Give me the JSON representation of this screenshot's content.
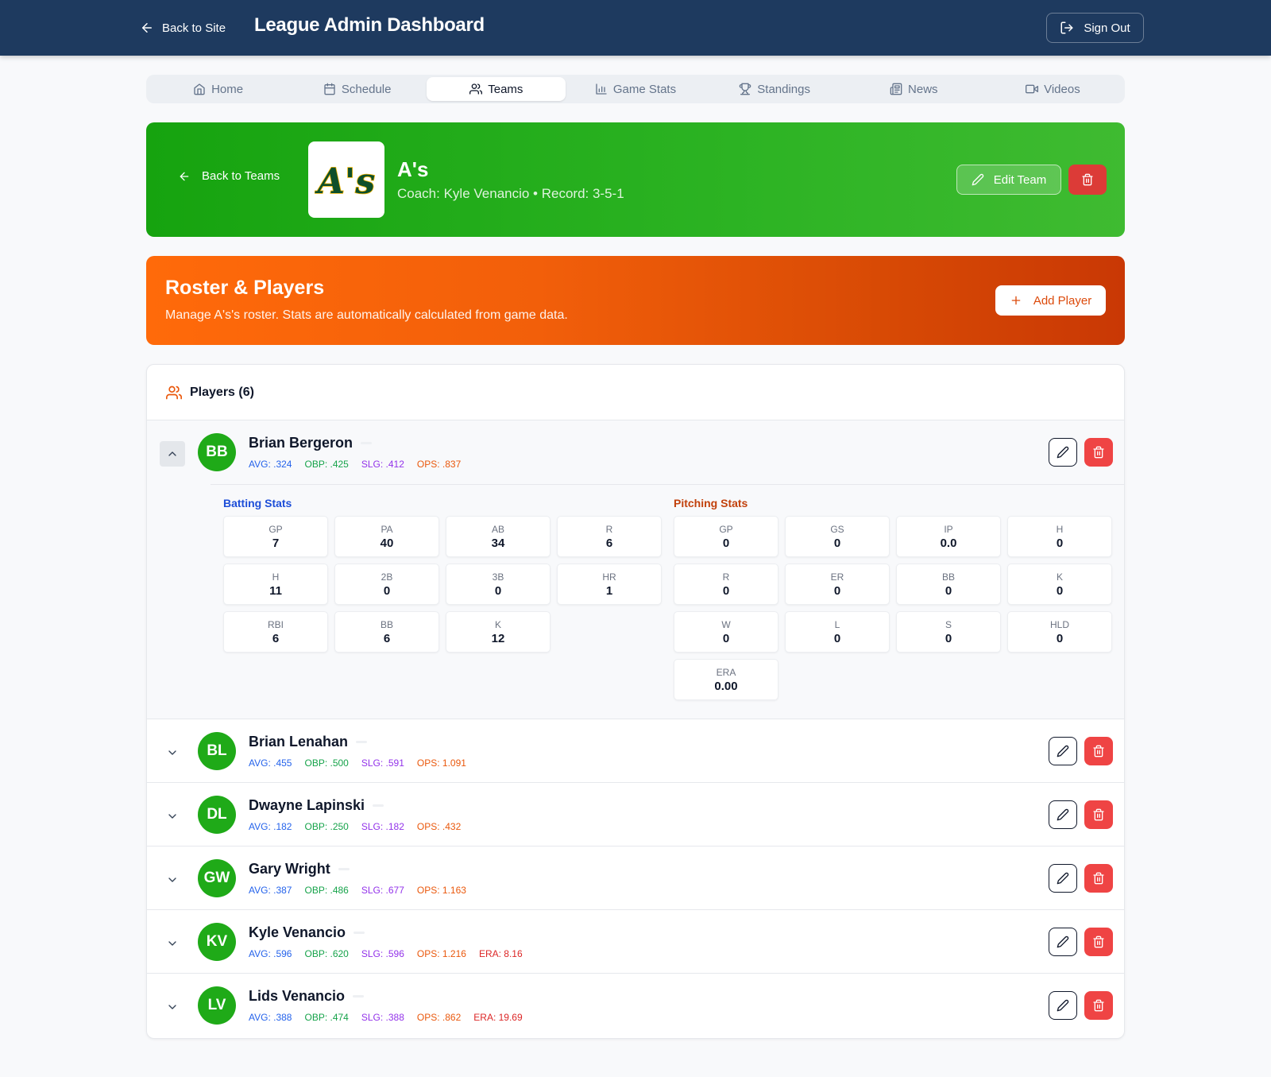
{
  "header": {
    "back_label": "Back to Site",
    "title": "League Admin Dashboard",
    "signout_label": "Sign Out"
  },
  "nav": {
    "tabs": [
      {
        "label": "Home",
        "icon": "home-icon"
      },
      {
        "label": "Schedule",
        "icon": "calendar-icon"
      },
      {
        "label": "Teams",
        "icon": "users-icon",
        "active": true
      },
      {
        "label": "Game Stats",
        "icon": "bar-chart-icon"
      },
      {
        "label": "Standings",
        "icon": "trophy-icon"
      },
      {
        "label": "News",
        "icon": "newspaper-icon"
      },
      {
        "label": "Videos",
        "icon": "video-icon"
      }
    ]
  },
  "team": {
    "back_label": "Back to Teams",
    "logo_text": "A's",
    "name": "A's",
    "meta": "Coach: Kyle Venancio • Record: 3-5-1",
    "edit_label": "Edit Team",
    "color": "#1faa18"
  },
  "roster": {
    "title": "Roster & Players",
    "subtitle": "Manage A's's roster. Stats are automatically calculated from game data.",
    "add_label": "Add Player"
  },
  "players_panel": {
    "title": "Players (6)"
  },
  "expanded_player": {
    "batting_title": "Batting Stats",
    "pitching_title": "Pitching Stats",
    "batting": [
      {
        "label": "GP",
        "value": "7"
      },
      {
        "label": "PA",
        "value": "40"
      },
      {
        "label": "AB",
        "value": "34"
      },
      {
        "label": "R",
        "value": "6"
      },
      {
        "label": "H",
        "value": "11"
      },
      {
        "label": "2B",
        "value": "0"
      },
      {
        "label": "3B",
        "value": "0"
      },
      {
        "label": "HR",
        "value": "1"
      },
      {
        "label": "RBI",
        "value": "6"
      },
      {
        "label": "BB",
        "value": "6"
      },
      {
        "label": "K",
        "value": "12"
      }
    ],
    "pitching": [
      {
        "label": "GP",
        "value": "0"
      },
      {
        "label": "GS",
        "value": "0"
      },
      {
        "label": "IP",
        "value": "0.0"
      },
      {
        "label": "H",
        "value": "0"
      },
      {
        "label": "R",
        "value": "0"
      },
      {
        "label": "ER",
        "value": "0"
      },
      {
        "label": "BB",
        "value": "0"
      },
      {
        "label": "K",
        "value": "0"
      },
      {
        "label": "W",
        "value": "0"
      },
      {
        "label": "L",
        "value": "0"
      },
      {
        "label": "S",
        "value": "0"
      },
      {
        "label": "HLD",
        "value": "0"
      },
      {
        "label": "ERA",
        "value": "0.00"
      }
    ]
  },
  "players": [
    {
      "initials": "BB",
      "name": "Brian Bergeron",
      "avg": "AVG: .324",
      "obp": "OBP: .425",
      "slg": "SLG: .412",
      "ops": "OPS: .837",
      "era": null,
      "expanded": true
    },
    {
      "initials": "BL",
      "name": "Brian Lenahan",
      "avg": "AVG: .455",
      "obp": "OBP: .500",
      "slg": "SLG: .591",
      "ops": "OPS: 1.091",
      "era": null
    },
    {
      "initials": "DL",
      "name": "Dwayne Lapinski",
      "avg": "AVG: .182",
      "obp": "OBP: .250",
      "slg": "SLG: .182",
      "ops": "OPS: .432",
      "era": null
    },
    {
      "initials": "GW",
      "name": "Gary Wright",
      "avg": "AVG: .387",
      "obp": "OBP: .486",
      "slg": "SLG: .677",
      "ops": "OPS: 1.163",
      "era": null
    },
    {
      "initials": "KV",
      "name": "Kyle Venancio",
      "avg": "AVG: .596",
      "obp": "OBP: .620",
      "slg": "SLG: .596",
      "ops": "OPS: 1.216",
      "era": "ERA: 8.16"
    },
    {
      "initials": "LV",
      "name": "Lids Venancio",
      "avg": "AVG: .388",
      "obp": "OBP: .474",
      "slg": "SLG: .388",
      "ops": "OPS: .862",
      "era": "ERA: 19.69"
    }
  ]
}
